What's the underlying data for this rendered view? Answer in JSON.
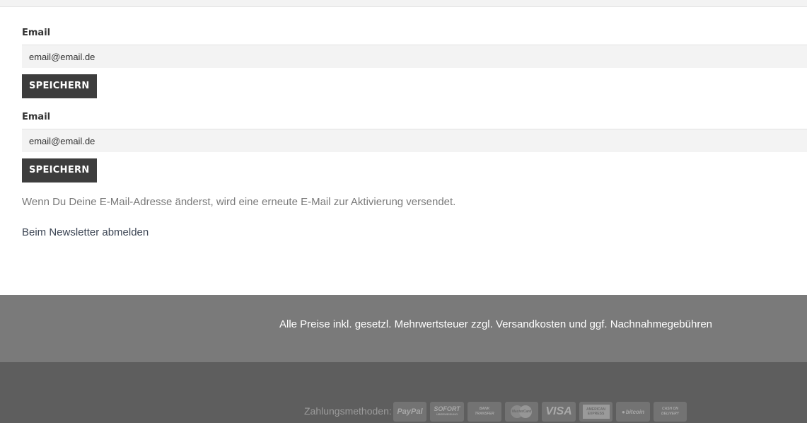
{
  "forms": [
    {
      "label": "Email",
      "value": "email@email.de",
      "button": "SPEICHERN"
    },
    {
      "label": "Email",
      "value": "email@email.de",
      "button": "SPEICHERN"
    }
  ],
  "info_text": "Wenn Du Deine E-Mail-Adresse änderst, wird eine erneute E-Mail zur Aktivierung versendet.",
  "unsubscribe_link": "Beim Newsletter abmelden",
  "footer": {
    "price_note": "Alle Preise inkl. gesetzl. Mehrwertsteuer zzgl. Versandkosten und ggf. Nachnahmegebühren",
    "payment_label": "Zahlungsmethoden:",
    "payment_methods": {
      "paypal": "PayPal",
      "sofort": "SOFORT",
      "sofort_sub": "ÜBERWEISUNG",
      "bank": "BANK",
      "bank_sub": "TRANSFER",
      "mastercard": "MasterCard",
      "visa": "VISA",
      "amex_top": "AMERICAN",
      "amex_bottom": "EXPRESS",
      "bitcoin": "bitcoin",
      "cod_top": "CASH ON",
      "cod_bottom": "DELIVERY"
    }
  }
}
